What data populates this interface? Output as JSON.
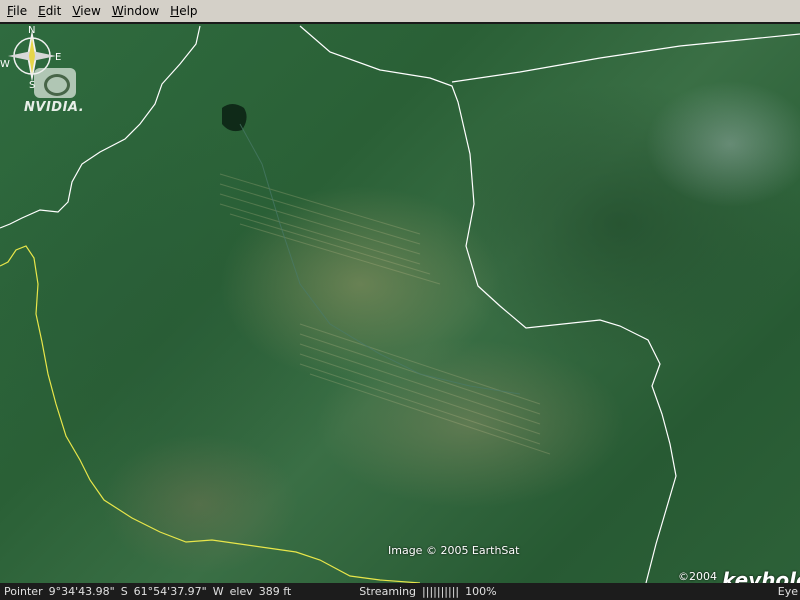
{
  "menu": {
    "items": [
      "File",
      "Edit",
      "View",
      "Window",
      "Help"
    ]
  },
  "overlay": {
    "logo_text": "NVIDIA.",
    "image_credit": "Image © 2005 EarthSat",
    "copyright": "©2004",
    "brand": "keyhole"
  },
  "compass": {
    "n": "N",
    "s": "S",
    "e": "E",
    "w": "W"
  },
  "status": {
    "pointer_label": "Pointer",
    "lat": "9°34'43.98\"",
    "lat_dir": "S",
    "lon": "61°54'37.97\"",
    "lon_dir": "W",
    "elev_label": "elev",
    "elev_value": "389 ft",
    "streaming_label": "Streaming",
    "streaming_bar": "||||||||||",
    "streaming_percent": "100%",
    "eye_label": "Eye"
  },
  "colors": {
    "menubar": "#d4d0c8",
    "statusbar": "#1c1c1c",
    "border_white": "#ffffff",
    "border_yellow": "#e8e64a"
  }
}
